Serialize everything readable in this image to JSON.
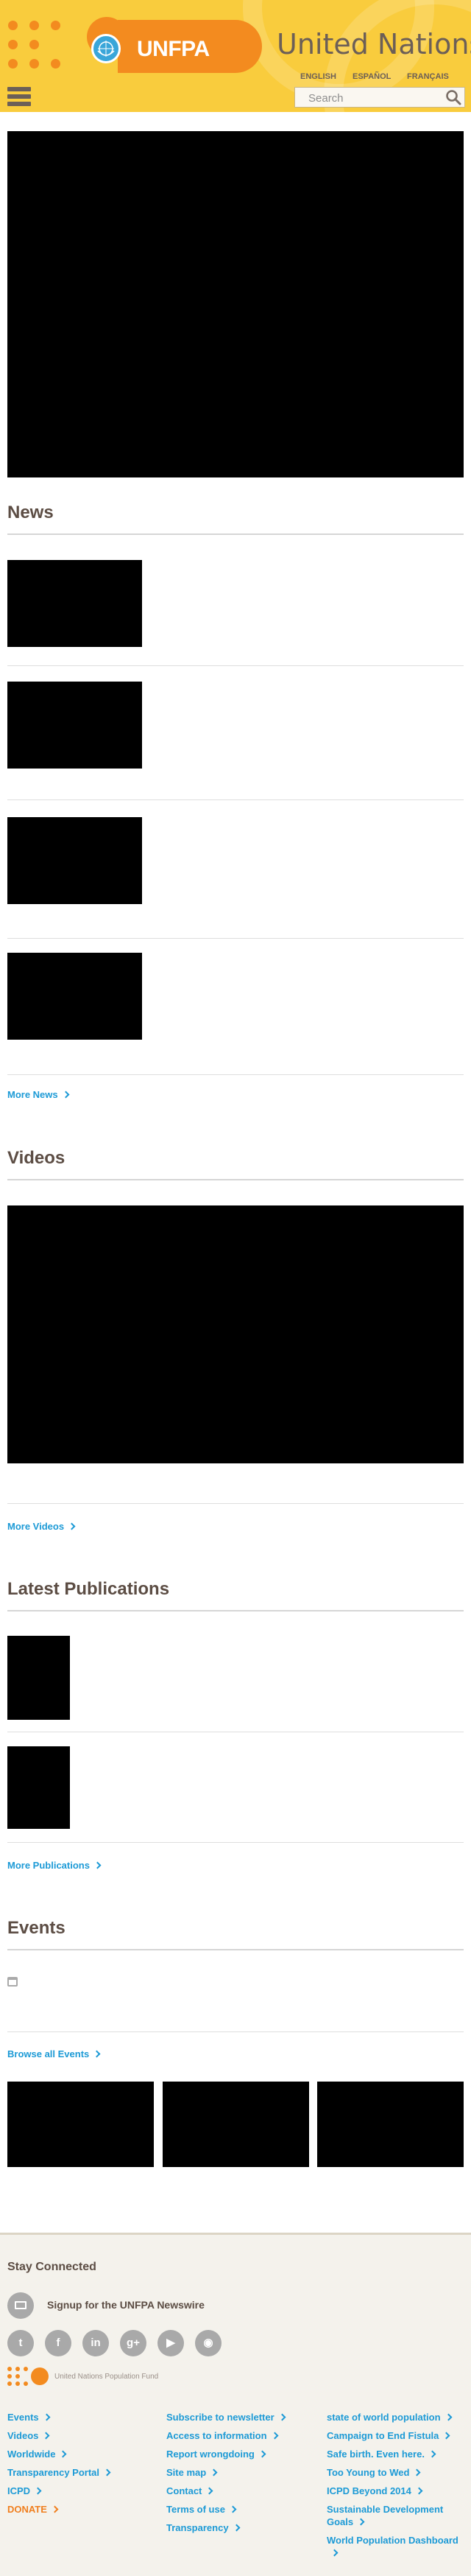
{
  "header": {
    "brand": "UNFPA",
    "site_title": "United Nations Population Fund",
    "languages": [
      "ENGLISH",
      "ESPAÑOL",
      "FRANÇAIS"
    ],
    "search_placeholder": "Search",
    "icons": {
      "menu": "hamburger-menu-icon",
      "search": "magnifier-icon"
    },
    "colors": {
      "header_bg": "#f9cc3d",
      "brand_orange": "#f38b1f",
      "un_blue": "#3aa6d9"
    }
  },
  "news": {
    "title": "News",
    "more_label": "More News"
  },
  "videos": {
    "title": "Videos",
    "more_label": "More Videos"
  },
  "publications": {
    "title": "Latest Publications",
    "more_label": "More Publications"
  },
  "events": {
    "title": "Events",
    "browse_label": "Browse all Events",
    "icons": {
      "calendar": "calendar-icon"
    }
  },
  "footer": {
    "stay_connected": "Stay Connected",
    "newswire": "Signup for the UNFPA Newswire",
    "org_name": "United Nations Population Fund",
    "social_icons": [
      "twitter-icon",
      "facebook-icon",
      "linkedin-icon",
      "googleplus-icon",
      "youtube-icon",
      "rss-icon"
    ],
    "social_glyphs": [
      "t",
      "f",
      "in",
      "g+",
      "▶",
      "◉"
    ],
    "col1": [
      "Events",
      "Videos",
      "Worldwide",
      "Transparency Portal",
      "ICPD",
      "DONATE"
    ],
    "col2": [
      "Subscribe to newsletter",
      "Access to information",
      "Report wrongdoing",
      "Site map",
      "Contact",
      "Terms of use",
      "Transparency"
    ],
    "col3": [
      "state of world population",
      "Campaign to End Fistula",
      "Safe birth. Even here.",
      "Too Young to Wed",
      "ICPD Beyond 2014",
      "Sustainable Development Goals",
      "World Population Dashboard"
    ],
    "colors": {
      "link": "#1c9ad6",
      "donate": "#f07f1f",
      "footer_bg": "#f4f2ec"
    }
  }
}
